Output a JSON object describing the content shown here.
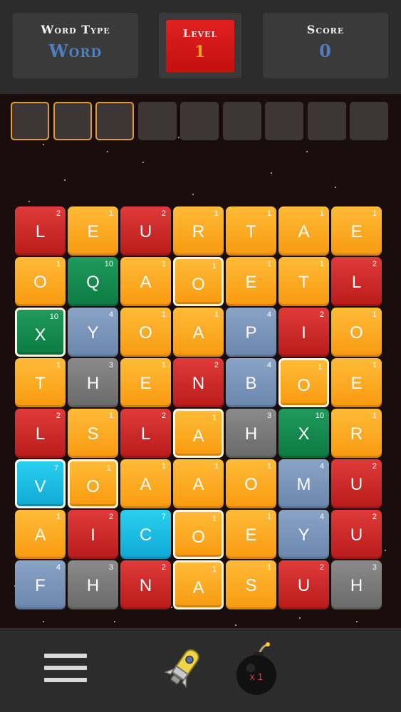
{
  "header": {
    "word_type_label": "Word Type",
    "word_type_value": "Word",
    "level_label": "Level",
    "level_value": "1",
    "score_label": "Score",
    "score_value": "0"
  },
  "word_slots": {
    "total": 9,
    "active": 3
  },
  "board": {
    "rows": [
      [
        {
          "l": "L",
          "p": "2",
          "c": "red"
        },
        {
          "l": "E",
          "p": "1",
          "c": "orange"
        },
        {
          "l": "U",
          "p": "2",
          "c": "red"
        },
        {
          "l": "R",
          "p": "1",
          "c": "orange"
        },
        {
          "l": "T",
          "p": "1",
          "c": "orange"
        },
        {
          "l": "A",
          "p": "1",
          "c": "orange"
        },
        {
          "l": "E",
          "p": "1",
          "c": "orange"
        }
      ],
      [
        {
          "l": "O",
          "p": "1",
          "c": "orange"
        },
        {
          "l": "Q",
          "p": "10",
          "c": "green"
        },
        {
          "l": "A",
          "p": "1",
          "c": "orange"
        },
        {
          "l": "O",
          "p": "1",
          "c": "orange",
          "s": true
        },
        {
          "l": "E",
          "p": "1",
          "c": "orange"
        },
        {
          "l": "T",
          "p": "1",
          "c": "orange"
        },
        {
          "l": "L",
          "p": "2",
          "c": "red"
        }
      ],
      [
        {
          "l": "X",
          "p": "10",
          "c": "green",
          "s": true
        },
        {
          "l": "Y",
          "p": "4",
          "c": "slate"
        },
        {
          "l": "O",
          "p": "1",
          "c": "orange"
        },
        {
          "l": "A",
          "p": "1",
          "c": "orange"
        },
        {
          "l": "P",
          "p": "4",
          "c": "slate"
        },
        {
          "l": "I",
          "p": "2",
          "c": "red"
        },
        {
          "l": "O",
          "p": "1",
          "c": "orange"
        }
      ],
      [
        {
          "l": "T",
          "p": "1",
          "c": "orange"
        },
        {
          "l": "H",
          "p": "3",
          "c": "gray"
        },
        {
          "l": "E",
          "p": "1",
          "c": "orange"
        },
        {
          "l": "N",
          "p": "2",
          "c": "red"
        },
        {
          "l": "B",
          "p": "4",
          "c": "slate"
        },
        {
          "l": "O",
          "p": "1",
          "c": "orange",
          "s": true
        },
        {
          "l": "E",
          "p": "1",
          "c": "orange"
        }
      ],
      [
        {
          "l": "L",
          "p": "2",
          "c": "red"
        },
        {
          "l": "S",
          "p": "1",
          "c": "orange"
        },
        {
          "l": "L",
          "p": "2",
          "c": "red"
        },
        {
          "l": "A",
          "p": "1",
          "c": "orange",
          "s": true
        },
        {
          "l": "H",
          "p": "3",
          "c": "gray"
        },
        {
          "l": "X",
          "p": "10",
          "c": "green"
        },
        {
          "l": "R",
          "p": "1",
          "c": "orange"
        }
      ],
      [
        {
          "l": "V",
          "p": "7",
          "c": "cyan",
          "s": true
        },
        {
          "l": "O",
          "p": "1",
          "c": "orange",
          "s": true
        },
        {
          "l": "A",
          "p": "1",
          "c": "orange"
        },
        {
          "l": "A",
          "p": "1",
          "c": "orange"
        },
        {
          "l": "O",
          "p": "1",
          "c": "orange"
        },
        {
          "l": "M",
          "p": "4",
          "c": "slate"
        },
        {
          "l": "U",
          "p": "2",
          "c": "red"
        }
      ],
      [
        {
          "l": "A",
          "p": "1",
          "c": "orange"
        },
        {
          "l": "I",
          "p": "2",
          "c": "red"
        },
        {
          "l": "C",
          "p": "7",
          "c": "cyan"
        },
        {
          "l": "O",
          "p": "1",
          "c": "orange",
          "s": true
        },
        {
          "l": "E",
          "p": "1",
          "c": "orange"
        },
        {
          "l": "Y",
          "p": "4",
          "c": "slate"
        },
        {
          "l": "U",
          "p": "2",
          "c": "red"
        }
      ],
      [
        {
          "l": "F",
          "p": "4",
          "c": "slate"
        },
        {
          "l": "H",
          "p": "3",
          "c": "gray"
        },
        {
          "l": "N",
          "p": "2",
          "c": "red"
        },
        {
          "l": "A",
          "p": "1",
          "c": "orange",
          "s": true
        },
        {
          "l": "S",
          "p": "1",
          "c": "orange"
        },
        {
          "l": "U",
          "p": "2",
          "c": "red"
        },
        {
          "l": "H",
          "p": "3",
          "c": "gray"
        }
      ]
    ]
  },
  "footer": {
    "bomb_count": "x 1",
    "menu_icon": "hamburger-menu-icon",
    "rocket_icon": "rocket-powerup-icon",
    "bomb_icon": "bomb-powerup-icon"
  }
}
